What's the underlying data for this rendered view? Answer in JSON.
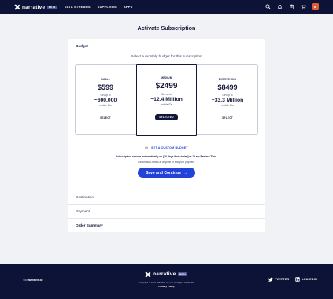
{
  "nav": {
    "brand": "narrative",
    "badge": "BETA",
    "links": [
      "DATA STREAMS",
      "SUPPLIERS",
      "APPS"
    ],
    "avatar_initial": "M",
    "icons": [
      "search-icon",
      "bell-icon",
      "clipboard-icon",
      "cart-icon"
    ]
  },
  "page": {
    "title": "Activate Subscription"
  },
  "budget": {
    "section_title": "Budget",
    "prompt": "Select a monthly budget for this subscription",
    "plans": [
      {
        "name": "SMALL",
        "price": "$599",
        "get_up": "Get up to",
        "count": "~600,000",
        "unit": "mobile IDs",
        "button": "SELECT",
        "selected": false
      },
      {
        "name": "MEDIUM",
        "price": "$2499",
        "get_up": "Get up to",
        "count": "~12.4 Million",
        "unit": "mobile IDs",
        "button": "SELECTED",
        "selected": true
      },
      {
        "name": "EVERYTHING",
        "price": "$8499",
        "get_up": "Get up to",
        "count": "~33.3 Million",
        "unit": "mobile IDs",
        "button": "SELECT",
        "selected": false
      }
    ],
    "or_label": "Or",
    "custom_link": "SET A CUSTOM BUDGET",
    "renew_text": "Subscription renews automatically on [30 days from today] at 12 am Eastern Time.",
    "cancel_text": "Cancel auto-renew at anytime or edit your payment.",
    "save_button": "Save and Continue",
    "save_arrow": "→"
  },
  "sections": {
    "destination": "Destination",
    "payment": "Payment",
    "order_summary": "Order Summary"
  },
  "footer": {
    "visit_prefix": "Visit",
    "visit_site": "Narrative.io",
    "brand": "narrative",
    "badge": "BETA",
    "copyright": "Copyright © 2020 Narrative I/O, Inc. All Rights Reserved.",
    "privacy": "Privacy Policy",
    "twitter": "TWITTER",
    "linkedin": "LINKEDIN"
  },
  "colors": {
    "nav_bg": "#0d1337",
    "accent": "#2343d8",
    "avatar": "#e05a35"
  }
}
